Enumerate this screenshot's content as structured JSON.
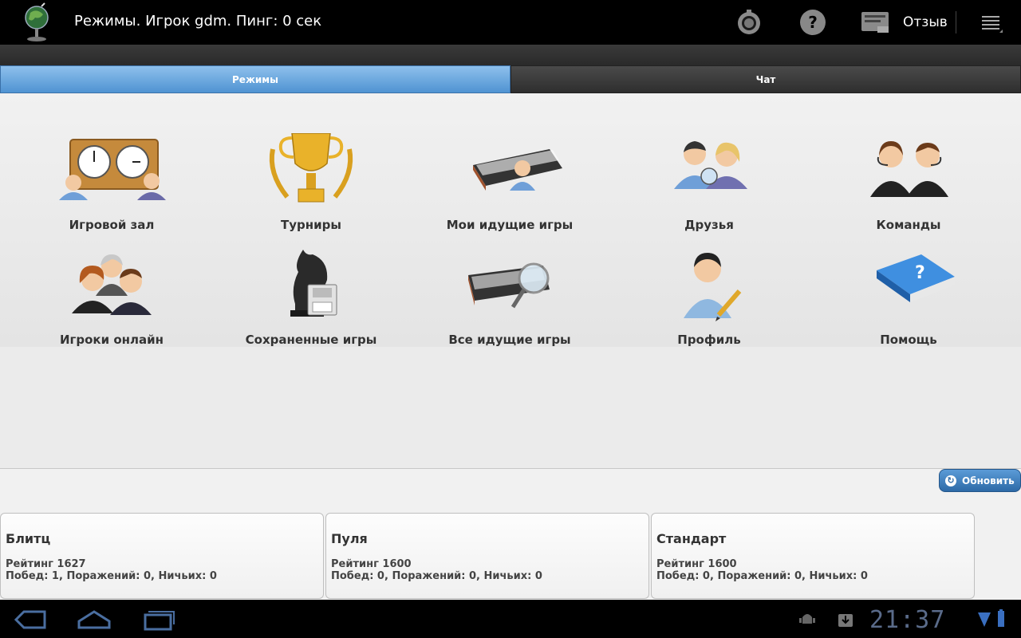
{
  "actionbar": {
    "title": "Режимы. Игрок gdm. Пинг: 0 сек",
    "feedback_label": "Отзыв",
    "icons": [
      "app-globe-icon",
      "settings-dial-icon",
      "help-icon",
      "feedback-icon",
      "overflow-menu-icon"
    ]
  },
  "tabs": [
    {
      "label": "Режимы",
      "active": true
    },
    {
      "label": "Чат",
      "active": false
    }
  ],
  "tiles": [
    {
      "label": "Игровой зал",
      "icon": "chess-clock-icon"
    },
    {
      "label": "Турниры",
      "icon": "trophy-icon"
    },
    {
      "label": "Мои идущие игры",
      "icon": "my-games-board-icon"
    },
    {
      "label": "Друзья",
      "icon": "friends-icon"
    },
    {
      "label": "Команды",
      "icon": "teams-headset-icon"
    },
    {
      "label": "Игроки онлайн",
      "icon": "players-online-icon"
    },
    {
      "label": "Сохраненные игры",
      "icon": "saved-games-knight-icon"
    },
    {
      "label": "Все идущие игры",
      "icon": "all-games-magnifier-icon"
    },
    {
      "label": "Профиль",
      "icon": "profile-pencil-icon"
    },
    {
      "label": "Помощь",
      "icon": "help-book-icon"
    }
  ],
  "refresh_label": "Обновить",
  "ratings": [
    {
      "title": "Блитц",
      "rating": "Рейтинг 1627",
      "stats": "Побед: 1, Поражений: 0, Ничьих: 0"
    },
    {
      "title": "Пуля",
      "rating": "Рейтинг 1600",
      "stats": "Побед: 0, Поражений: 0, Ничьих: 0"
    },
    {
      "title": "Стандарт",
      "rating": "Рейтинг 1600",
      "stats": "Побед: 0, Поражений: 0, Ничьих: 0"
    }
  ],
  "system": {
    "clock": "21:37"
  },
  "colors": {
    "tab_active": "#4f93d2",
    "refresh_button": "#2d6aa7"
  }
}
